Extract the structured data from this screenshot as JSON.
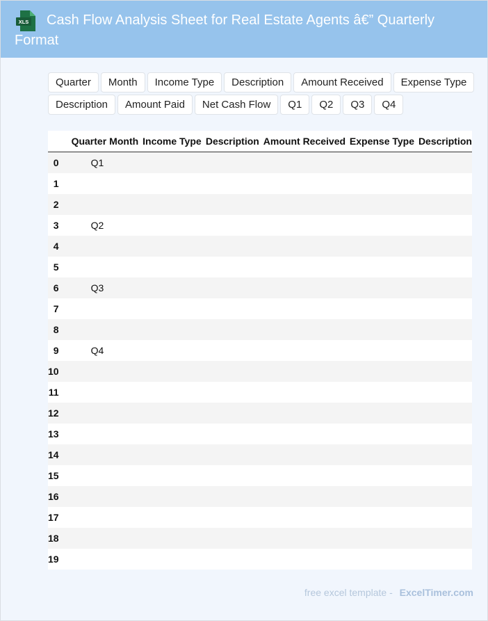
{
  "header": {
    "title": "Cash Flow Analysis Sheet for Real Estate Agents â€” Quarterly Format",
    "icon_text": "XLS",
    "icon_color": "#1e7145"
  },
  "chips": [
    "Quarter",
    "Month",
    "Income Type",
    "Description",
    "Amount Received",
    "Expense Type",
    "Description",
    "Amount Paid",
    "Net Cash Flow",
    "Q1",
    "Q2",
    "Q3",
    "Q4"
  ],
  "table": {
    "columns": [
      "",
      "Quarter",
      "Month",
      "Income Type",
      "Description",
      "Amount Received",
      "Expense Type",
      "Description"
    ],
    "rows": [
      {
        "idx": "0",
        "quarter": "Q1"
      },
      {
        "idx": "1",
        "quarter": ""
      },
      {
        "idx": "2",
        "quarter": ""
      },
      {
        "idx": "3",
        "quarter": "Q2"
      },
      {
        "idx": "4",
        "quarter": ""
      },
      {
        "idx": "5",
        "quarter": ""
      },
      {
        "idx": "6",
        "quarter": "Q3"
      },
      {
        "idx": "7",
        "quarter": ""
      },
      {
        "idx": "8",
        "quarter": ""
      },
      {
        "idx": "9",
        "quarter": "Q4"
      },
      {
        "idx": "10",
        "quarter": ""
      },
      {
        "idx": "11",
        "quarter": ""
      },
      {
        "idx": "12",
        "quarter": ""
      },
      {
        "idx": "13",
        "quarter": ""
      },
      {
        "idx": "14",
        "quarter": ""
      },
      {
        "idx": "15",
        "quarter": ""
      },
      {
        "idx": "16",
        "quarter": ""
      },
      {
        "idx": "17",
        "quarter": ""
      },
      {
        "idx": "18",
        "quarter": ""
      },
      {
        "idx": "19",
        "quarter": ""
      }
    ]
  },
  "footer": {
    "text": "free excel template -",
    "brand": "ExcelTimer.com"
  },
  "colors": {
    "header_bg": "#96c3ec",
    "page_bg": "#f1f6fd",
    "stripe": "#f4f4f4"
  }
}
